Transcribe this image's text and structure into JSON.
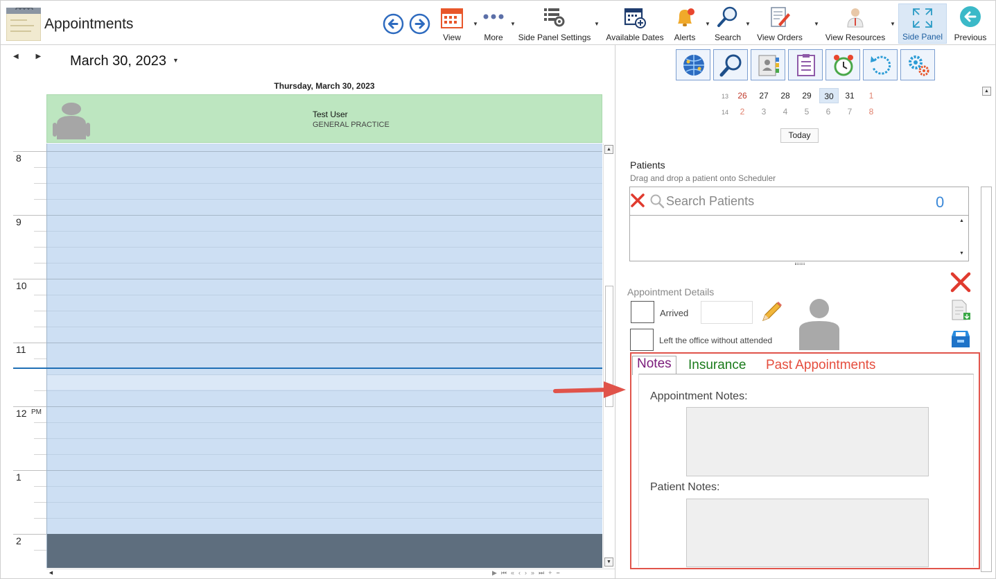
{
  "app": {
    "title": "Appointments"
  },
  "toolbar": {
    "buttons": [
      {
        "label": "View"
      },
      {
        "label": "More"
      },
      {
        "label": "Side Panel Settings"
      },
      {
        "label": "Available Dates"
      },
      {
        "label": "Alerts"
      },
      {
        "label": "Search"
      },
      {
        "label": "View Orders"
      },
      {
        "label": "View Resources"
      },
      {
        "label": "Side Panel"
      },
      {
        "label": "Previous"
      }
    ]
  },
  "scheduler": {
    "date_title": "March 30, 2023",
    "day_header": "Thursday, March 30, 2023",
    "resource": {
      "name": "Test User",
      "department": "GENERAL PRACTICE"
    },
    "hours": [
      "8",
      "9",
      "10",
      "11",
      "12",
      "1",
      "2"
    ],
    "pm_marker": "PM"
  },
  "mini_calendar": {
    "weeks": [
      {
        "week": "13",
        "days": [
          "26",
          "27",
          "28",
          "29",
          "30",
          "31",
          "1"
        ]
      },
      {
        "week": "14",
        "days": [
          "2",
          "3",
          "4",
          "5",
          "6",
          "7",
          "8"
        ]
      }
    ],
    "selected_day": "30",
    "today_label": "Today"
  },
  "patients": {
    "title": "Patients",
    "hint": "Drag and drop a patient onto Scheduler",
    "search_placeholder": "Search Patients",
    "count": "0"
  },
  "appointment_details": {
    "title": "Appointment Details",
    "arrived_label": "Arrived",
    "left_label": "Left the office without attended"
  },
  "tabs": [
    {
      "label": "Notes"
    },
    {
      "label": "Insurance"
    },
    {
      "label": "Past Appointments"
    }
  ],
  "notes": {
    "appointment_notes_label": "Appointment Notes:",
    "patient_notes_label": "Patient Notes:"
  },
  "colors": {
    "accent": "#1f6fb5",
    "resource_header": "#bde6c0",
    "grid": "#cddff3",
    "after_hours": "#5e6e7e",
    "highlight_box": "#e0534a",
    "tab_notes": "#7a1a7a",
    "tab_insurance": "#197a1a",
    "tab_past": "#e54d3d"
  }
}
